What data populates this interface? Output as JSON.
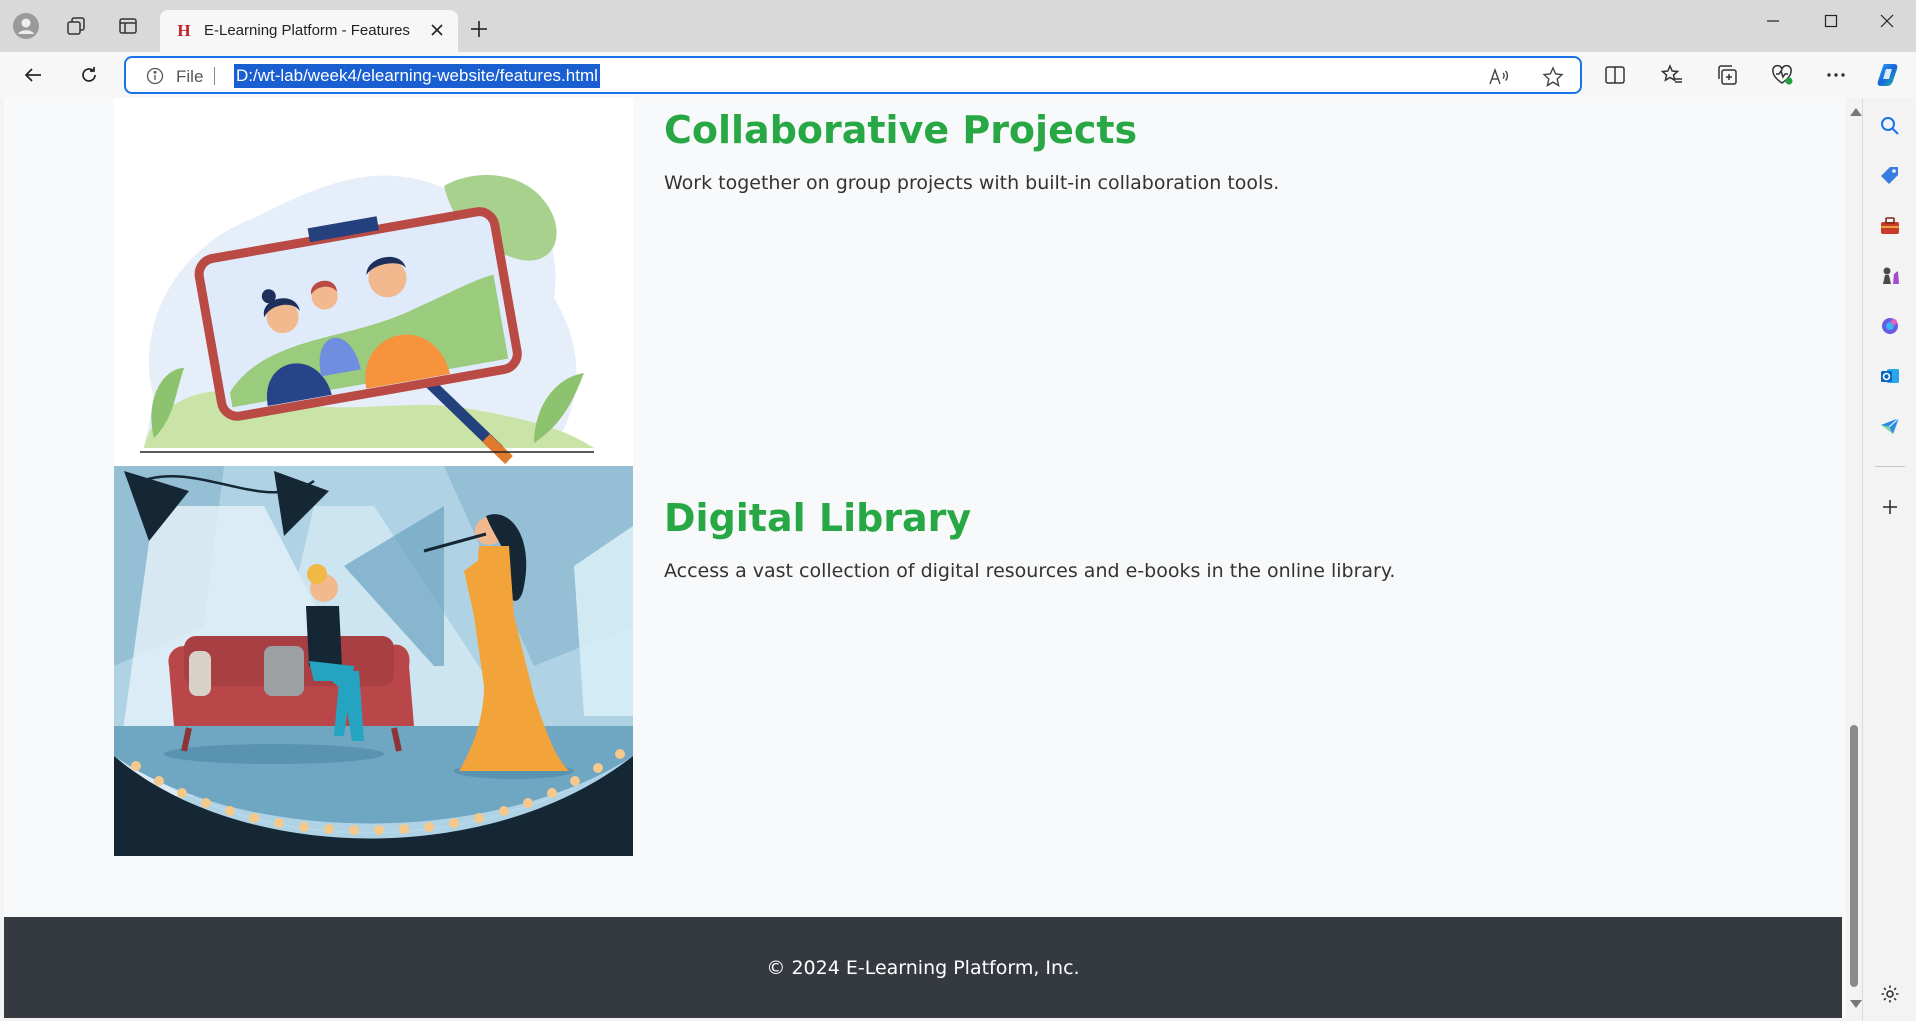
{
  "browser": {
    "tab_title": "E-Learning Platform - Features",
    "tab_favicon": "H",
    "address_prefix": "File",
    "url": "D:/wt-lab/week4/elearning-website/features.html",
    "accent_color": "#1a73e8"
  },
  "page": {
    "features": [
      {
        "title": "Collaborative Projects",
        "description": "Work together on group projects with built-in collaboration tools."
      },
      {
        "title": "Digital Library",
        "description": "Access a vast collection of digital resources and e-books in the online library."
      }
    ],
    "footer": "© 2024 E-Learning Platform, Inc.",
    "colors": {
      "heading": "#28a745",
      "footer_bg": "#343a40"
    }
  },
  "sidebar_icons": [
    "search-icon",
    "tag-icon",
    "toolbox-icon",
    "chess-icon",
    "copilot-icon",
    "outlook-icon",
    "send-icon",
    "add-icon",
    "settings-icon"
  ]
}
